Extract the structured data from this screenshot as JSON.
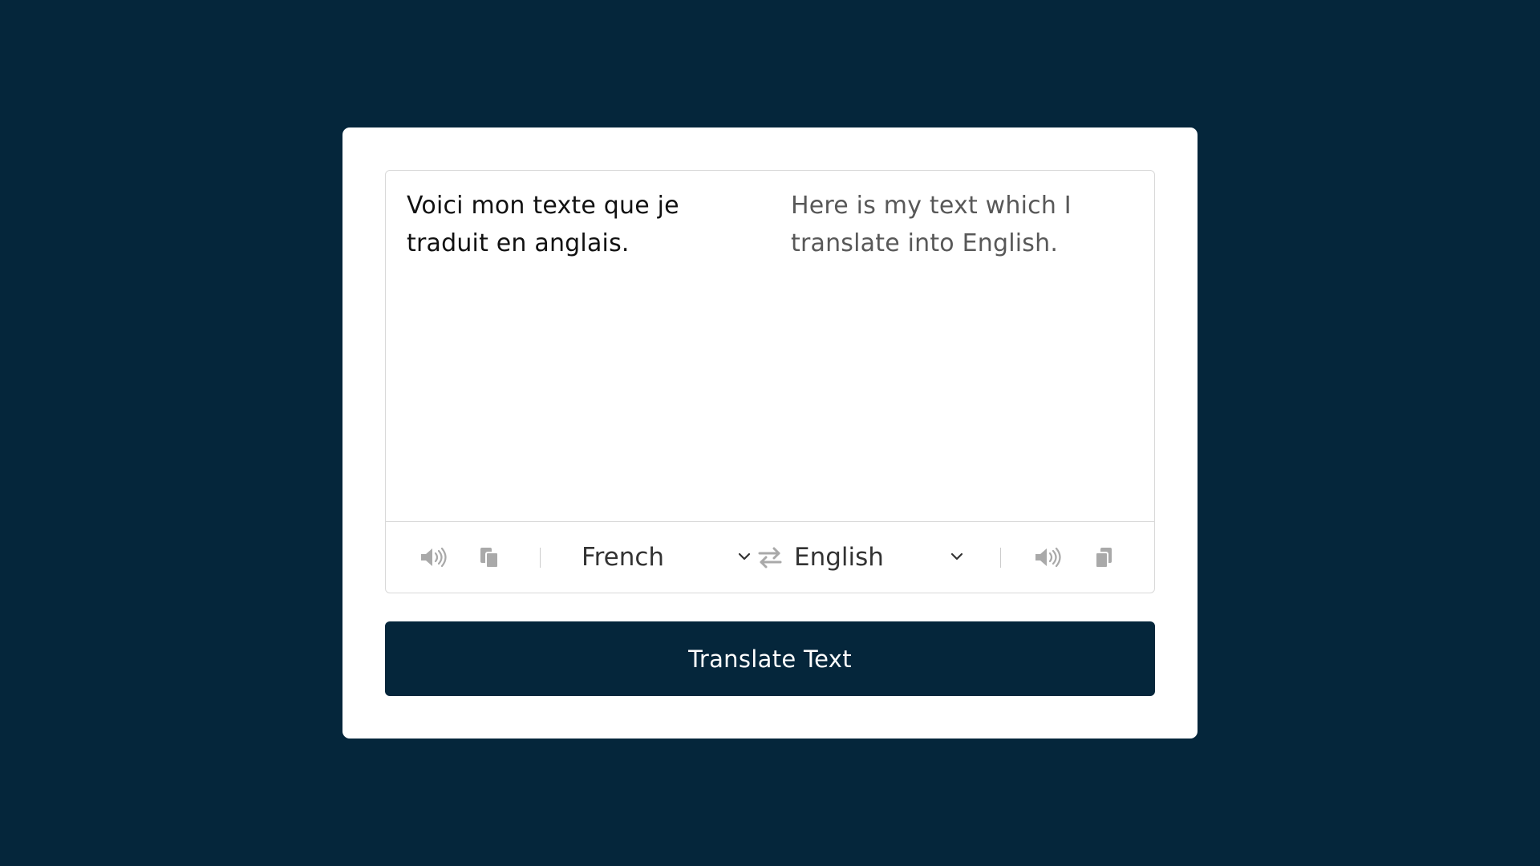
{
  "translator": {
    "from_text": "Voici mon texte que je traduit en anglais.",
    "to_text": "Here is my text which I translate into English.",
    "from_language": "French",
    "to_language": "English",
    "translate_button_label": "Translate Text"
  },
  "icons": {
    "from_speaker": "speaker-icon",
    "from_copy": "copy-icon",
    "exchange": "exchange-icon",
    "to_speaker": "speaker-icon",
    "to_copy": "copy-icon"
  },
  "colors": {
    "background": "#05263b",
    "card": "#ffffff",
    "button": "#05263b",
    "icon": "#a9a9a9"
  }
}
